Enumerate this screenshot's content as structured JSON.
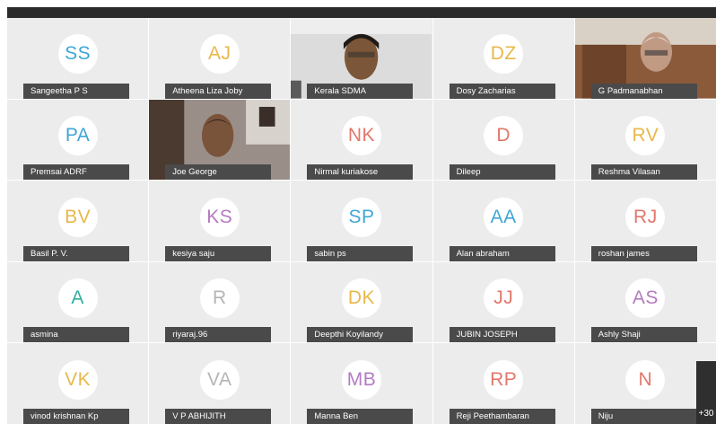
{
  "participants": [
    {
      "name": "Sangeetha P S",
      "initials": "SS",
      "color": "#3ea6d6",
      "video": false
    },
    {
      "name": "Atheena Liza Joby",
      "initials": "AJ",
      "color": "#e8b84a",
      "video": false
    },
    {
      "name": "Kerala SDMA",
      "initials": "",
      "color": "",
      "video": true
    },
    {
      "name": "Dosy Zacharias",
      "initials": "DZ",
      "color": "#e8b84a",
      "video": false
    },
    {
      "name": "G Padmanabhan",
      "initials": "",
      "color": "",
      "video": true
    },
    {
      "name": "Premsai ADRF",
      "initials": "PA",
      "color": "#3ea6d6",
      "video": false
    },
    {
      "name": "Joe George",
      "initials": "",
      "color": "",
      "video": true
    },
    {
      "name": "Nirmal kuriakose",
      "initials": "NK",
      "color": "#e2776a",
      "video": false
    },
    {
      "name": "Dileep",
      "initials": "D",
      "color": "#e2776a",
      "video": false
    },
    {
      "name": "Reshma Vilasan",
      "initials": "RV",
      "color": "#e8b84a",
      "video": false
    },
    {
      "name": "Basil P. V.",
      "initials": "BV",
      "color": "#e8b84a",
      "video": false
    },
    {
      "name": "kesiya saju",
      "initials": "KS",
      "color": "#b57ac2",
      "video": false
    },
    {
      "name": "sabin ps",
      "initials": "SP",
      "color": "#3ea6d6",
      "video": false
    },
    {
      "name": "Alan abraham",
      "initials": "AA",
      "color": "#3ea6d6",
      "video": false
    },
    {
      "name": "roshan james",
      "initials": "RJ",
      "color": "#e2776a",
      "video": false
    },
    {
      "name": "asmina",
      "initials": "A",
      "color": "#2fae9c",
      "video": false
    },
    {
      "name": "riyaraj.96",
      "initials": "R",
      "color": "#b5b5b5",
      "video": false
    },
    {
      "name": "Deepthi Koyilandy",
      "initials": "DK",
      "color": "#e8b84a",
      "video": false
    },
    {
      "name": "JUBIN JOSEPH",
      "initials": "JJ",
      "color": "#e2776a",
      "video": false
    },
    {
      "name": "Ashly Shaji",
      "initials": "AS",
      "color": "#b57ac2",
      "video": false
    },
    {
      "name": "vinod krishnan Kp",
      "initials": "VK",
      "color": "#e8b84a",
      "video": false
    },
    {
      "name": "V P ABHIJITH",
      "initials": "VA",
      "color": "#b5b5b5",
      "video": false
    },
    {
      "name": "Manna Ben",
      "initials": "MB",
      "color": "#b57ac2",
      "video": false
    },
    {
      "name": "Reji Peethambaran",
      "initials": "RP",
      "color": "#e2776a",
      "video": false
    },
    {
      "name": "Niju",
      "initials": "N",
      "color": "#e2776a",
      "video": false
    }
  ],
  "more_count": "+30"
}
